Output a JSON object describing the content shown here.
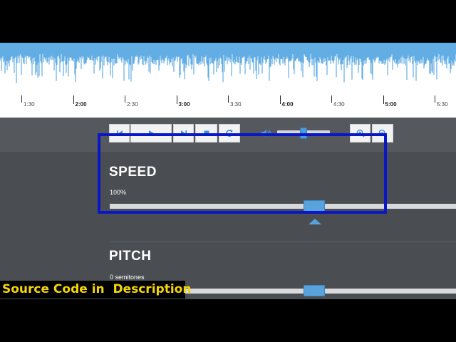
{
  "ruler": {
    "labels": [
      {
        "text": "1:30",
        "major": false
      },
      {
        "text": "2:00",
        "major": true
      },
      {
        "text": "2:30",
        "major": false
      },
      {
        "text": "3:00",
        "major": true
      },
      {
        "text": "3:30",
        "major": false
      },
      {
        "text": "4:00",
        "major": true
      },
      {
        "text": "4:30",
        "major": false
      },
      {
        "text": "5:00",
        "major": true
      },
      {
        "text": "5:30",
        "major": false
      }
    ]
  },
  "transport": {
    "buttons": [
      {
        "name": "skip-back-button",
        "icon": "skip-back-icon"
      },
      {
        "name": "play-button",
        "icon": "play-icon"
      },
      {
        "name": "skip-forward-button",
        "icon": "skip-forward-icon"
      },
      {
        "name": "stop-button",
        "icon": "stop-icon"
      },
      {
        "name": "loop-button",
        "icon": "refresh-icon"
      }
    ],
    "volume": {
      "icon": "volume-icon",
      "level": 0.5
    },
    "zoom": [
      {
        "name": "zoom-in-button",
        "icon": "zoom-in-icon"
      },
      {
        "name": "zoom-out-button",
        "icon": "zoom-out-icon"
      }
    ]
  },
  "speed": {
    "title": "SPEED",
    "value": "100%",
    "level": 0.59
  },
  "pitch": {
    "title": "PITCH",
    "value": "0 semitones",
    "level": 0.59
  },
  "caption": "Source Code in  Description",
  "colors": {
    "accent": "#5aa2dc",
    "waveform": "#62ade3",
    "panel_bg": "#4a4d51",
    "highlight_box": "#0a17c8",
    "caption_text": "#f5d60a"
  }
}
